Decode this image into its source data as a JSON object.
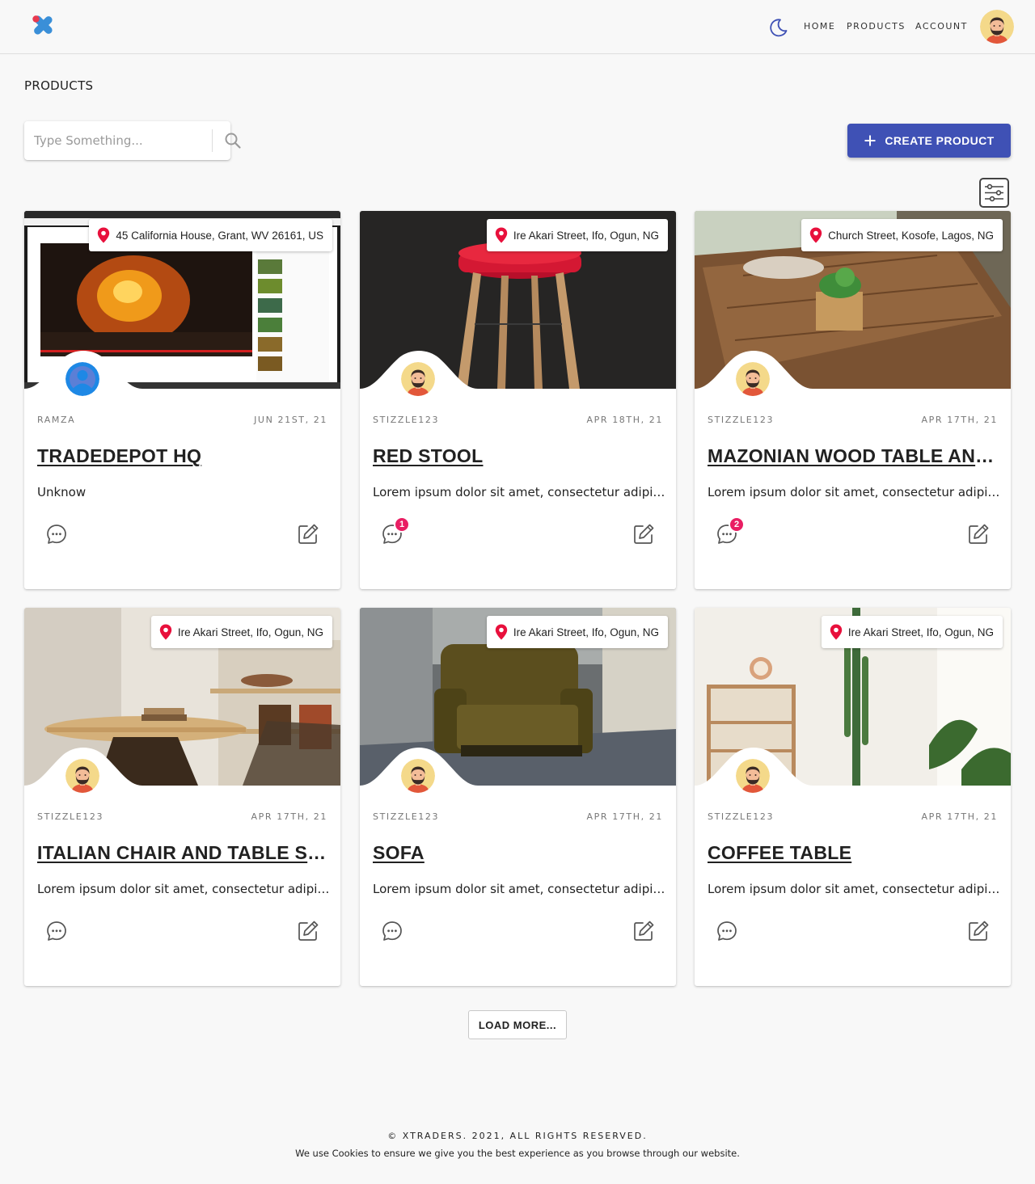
{
  "header": {
    "logo_icon": "x-logo-icon",
    "theme_toggle_icon": "moon-icon",
    "nav": [
      {
        "label": "HOME"
      },
      {
        "label": "PRODUCTS"
      },
      {
        "label": "ACCOUNT"
      }
    ],
    "avatar_icon": "avatar-icon"
  },
  "page": {
    "title": "PRODUCTS"
  },
  "search": {
    "placeholder": "Type Something...",
    "value": "",
    "icon": "search-icon"
  },
  "toolbar": {
    "create_label": "CREATE PRODUCT",
    "create_icon": "plus-icon",
    "filter_icon": "sliders-icon",
    "accent_color": "#3f51b5"
  },
  "products": [
    {
      "location": "45 California House, Grant, WV 26161, US",
      "author": "RAMZA",
      "date": "JUN 21ST, 21",
      "title": "TRADEDEPOT HQ",
      "description": "Unknow",
      "comments": null
    },
    {
      "location": "Ire Akari Street, Ifo, Ogun, NG",
      "author": "STIZZLE123",
      "date": "APR 18TH, 21",
      "title": "RED STOOL",
      "description": "Lorem ipsum dolor sit amet, consectetur adipiscing elit",
      "comments": 1
    },
    {
      "location": "Church Street, Kosofe, Lagos, NG",
      "author": "STIZZLE123",
      "date": "APR 17TH, 21",
      "title": "MAZONIAN WOOD TABLE AND CHAIRS",
      "description": "Lorem ipsum dolor sit amet, consectetur adipiscing elit",
      "comments": 2
    },
    {
      "location": "Ire Akari Street, Ifo, Ogun, NG",
      "author": "STIZZLE123",
      "date": "APR 17TH, 21",
      "title": "ITALIAN CHAIR AND TABLE SET",
      "description": "Lorem ipsum dolor sit amet, consectetur adipiscing elit",
      "comments": null
    },
    {
      "location": "Ire Akari Street, Ifo, Ogun, NG",
      "author": "STIZZLE123",
      "date": "APR 17TH, 21",
      "title": "SOFA",
      "description": "Lorem ipsum dolor sit amet, consectetur adipiscing elit",
      "comments": null
    },
    {
      "location": "Ire Akari Street, Ifo, Ogun, NG",
      "author": "STIZZLE123",
      "date": "APR 17TH, 21",
      "title": "COFFEE TABLE",
      "description": "Lorem ipsum dolor sit amet, consectetur adipiscing elit",
      "comments": null
    }
  ],
  "card_icons": {
    "location": "map-pin-icon",
    "comment": "comment-icon",
    "edit": "edit-icon",
    "pin_color": "#e8103c",
    "badge_color": "#e91e63"
  },
  "load_more": {
    "label": "LOAD MORE..."
  },
  "footer": {
    "copyright": "© XTRADERS. 2021, ALL RIGHTS RESERVED.",
    "cookies": "We use Cookies to ensure we give you the best experience as you browse through our website."
  }
}
